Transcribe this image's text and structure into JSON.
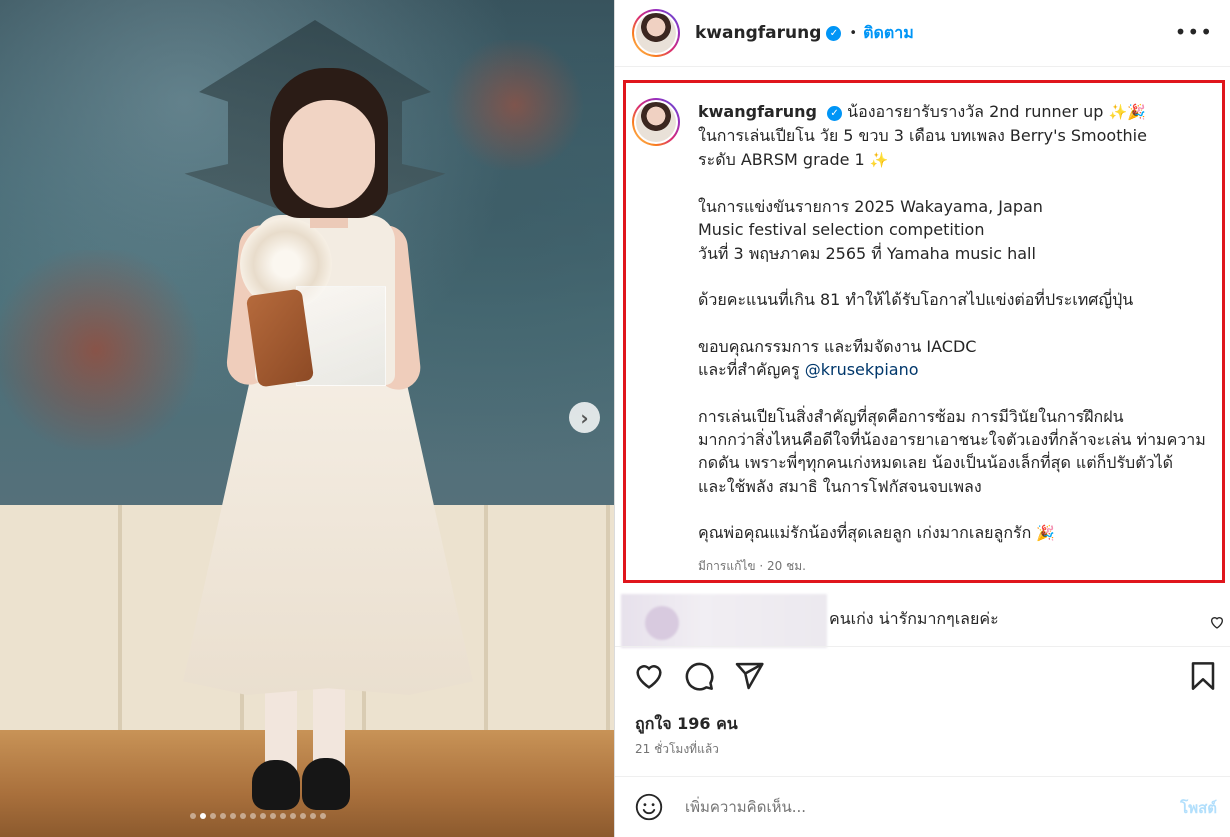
{
  "post": {
    "photo": {
      "alt_icon": "photo-image",
      "dot_count": 14,
      "active_dot": 1
    },
    "header": {
      "username": "kwangfarung",
      "verified_mark": "✓",
      "separator": "•",
      "follow_label": "ติดตาม",
      "more_label": "•••"
    },
    "caption": {
      "username": "kwangfarung",
      "verified_mark": "✓",
      "lines": [
        "น้องอารยารับรางวัล 2nd runner up",
        "ในการเล่นเปียโน วัย 5 ขวบ 3 เดือน บทเพลง Berry's Smoothie",
        "ระดับ ABRSM grade 1",
        "",
        "ในการแข่งขันรายการ 2025 Wakayama, Japan",
        "Music festival selection competition",
        "วันที่ 3 พฤษภาคม 2565 ที่ Yamaha music hall",
        "",
        "ด้วยคะแนนที่เกิน 81 ทำให้ได้รับโอกาสไปแข่งต่อที่ประเทศญี่ปุ่น",
        "",
        "ขอบคุณกรรมการ และทีมจัดงาน IACDC",
        "และที่สำคัญครู",
        "",
        "การเล่นเปียโนสิ่งสำคัญที่สุดคือการซ้อม การมีวินัยในการฝึกฝน",
        "มากกว่าสิ่งไหนคือดีใจที่น้องอารยาเอาชนะใจตัวเองที่กล้าจะเล่น ท่ามความ",
        "กดดัน เพราะพี่ๆทุกคนเก่งหมดเลย น้องเป็นน้องเล็กที่สุด แต่ก็ปรับตัวได้",
        "และใช้พลัง สมาธิ ในการโฟกัสจนจบเพลง",
        "",
        "คุณพ่อคุณแม่รักน้องที่สุดเลยลูก เก่งมากเลยลูกรัก"
      ],
      "mention": "@krusekpiano",
      "emoji_sparkles": "✨",
      "emoji_party": "🎉",
      "meta": "มีการแก้ไข · 20 ชม."
    },
    "comment": {
      "text": "คนเก่ง น่ารักมากๆเลยค่ะ"
    },
    "actions": {
      "icons": [
        "heart-icon",
        "comment-icon",
        "share-icon",
        "bookmark-icon"
      ]
    },
    "likes": "ถูกใจ 196 คน",
    "time_ago": "21 ชั่วโมงที่แล้ว",
    "add_comment": {
      "placeholder": "เพิ่มความคิดเห็น...",
      "post_label": "โพสต์"
    },
    "colors": {
      "accent": "#0095f6",
      "highlight_border": "#e0151c",
      "mention": "#00376b"
    }
  }
}
